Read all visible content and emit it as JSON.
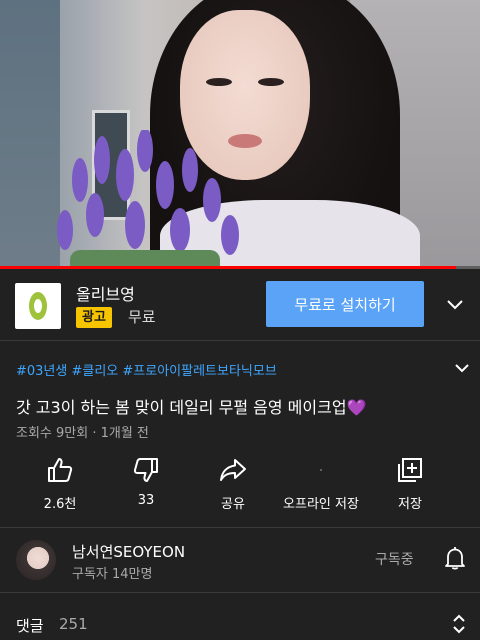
{
  "video": {
    "progress_fraction": 0.95
  },
  "ad": {
    "name": "올리브영",
    "badge": "광고",
    "price": "무료",
    "install_label": "무료로 설치하기",
    "brand_color": "#9ec23c",
    "button_color": "#5aa3f7"
  },
  "video_info": {
    "hashtags": "#03년생 #클리오 #프로아이팔레트보타닉모브",
    "title": "갓 고3이 하는 봄 맞이 데일리 무펄 음영 메이크업💜",
    "meta": "조회수 9만회 · 1개월 전"
  },
  "actions": [
    {
      "icon": "thumbs-up-icon",
      "label": "2.6천"
    },
    {
      "icon": "thumbs-down-icon",
      "label": "33"
    },
    {
      "icon": "share-icon",
      "label": "공유"
    },
    {
      "icon": "download-icon",
      "label": "오프라인 저장"
    },
    {
      "icon": "save-playlist-icon",
      "label": "저장"
    }
  ],
  "channel": {
    "name": "남서연SEOYEON",
    "subscribers": "구독자 14만명",
    "subscribe_state": "구독중"
  },
  "comments": {
    "label": "댓글",
    "count": "251"
  },
  "colors": {
    "background": "#212121",
    "hashtag": "#3ea6ff",
    "progress": "#ff0000"
  }
}
